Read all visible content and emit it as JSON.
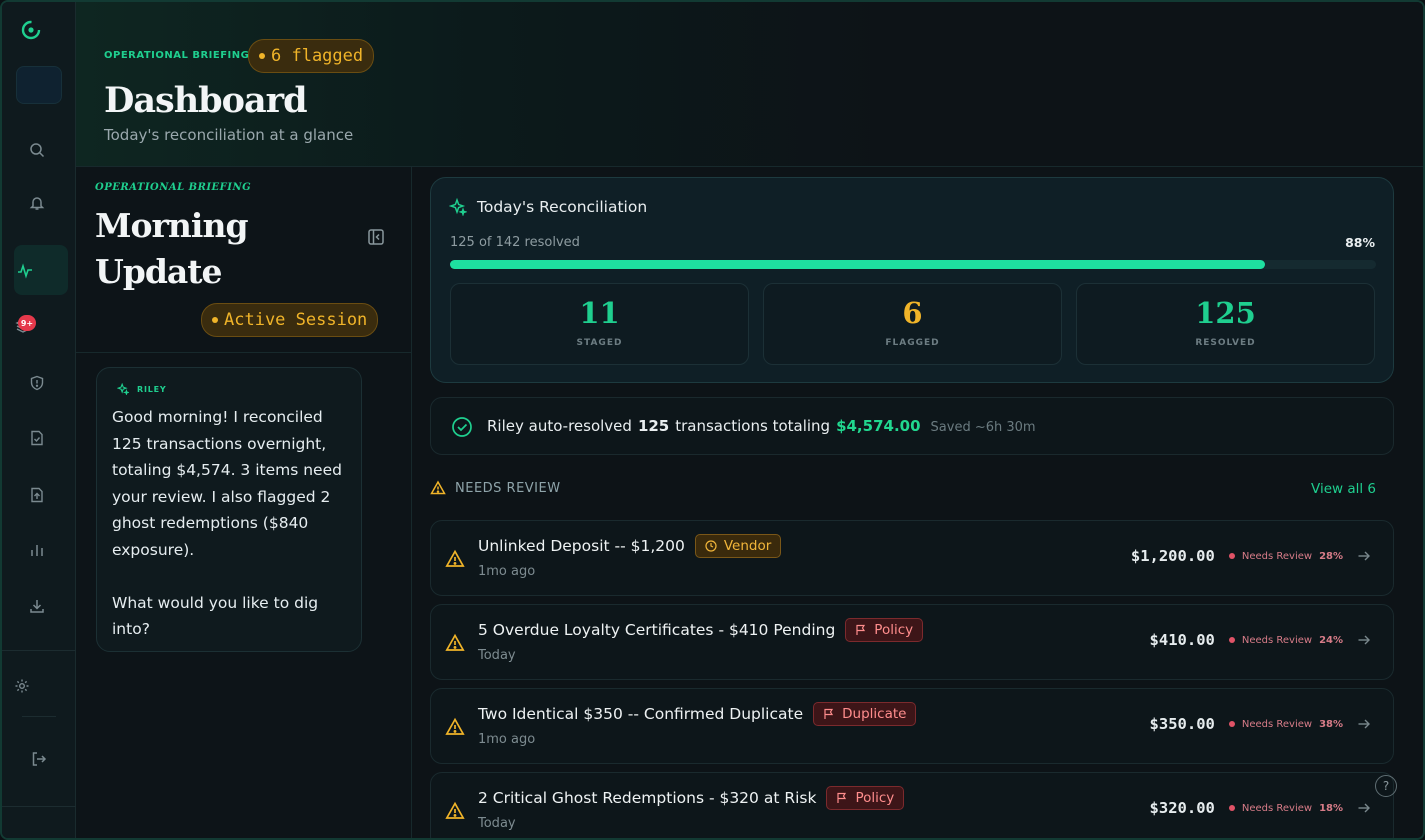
{
  "header": {
    "eyebrow": "OPERATIONAL BRIEFING",
    "flag_pill": "6 flagged",
    "title": "Dashboard",
    "subtitle": "Today's reconciliation at a glance"
  },
  "rail": {
    "notifications_badge": "9+",
    "icons": [
      "logo-icon",
      "search-icon",
      "bell-icon",
      "activity-icon",
      "layers-icon",
      "shield-icon",
      "file-check-icon",
      "file-upload-icon",
      "bar-chart-icon",
      "download-icon",
      "settings-icon",
      "logout-icon"
    ]
  },
  "briefing": {
    "eyebrow": "OPERATIONAL BRIEFING",
    "title": "Morning Update",
    "session_pill": "Active Session",
    "assistant_name": "RILEY",
    "message": "Good morning! I reconciled 125 transactions overnight, totaling $4,574. 3 items need your review. I also flagged 2 ghost redemptions ($840 exposure).\n\nWhat would you like to dig into?"
  },
  "reconciliation": {
    "title": "Today's Reconciliation",
    "progress_label": "125 of 142 resolved",
    "progress_pct_label": "88%",
    "progress_fraction": 0.88,
    "stats": [
      {
        "value": "11",
        "label": "STAGED",
        "color": "#1fcf8f"
      },
      {
        "value": "6",
        "label": "FLAGGED",
        "color": "#f0b429"
      },
      {
        "value": "125",
        "label": "RESOLVED",
        "color": "#1fcf8f"
      }
    ]
  },
  "auto_resolved": {
    "prefix": "Riley auto-resolved",
    "count": "125",
    "middle": "transactions totaling",
    "amount": "$4,574.00",
    "saved": "Saved ~6h 30m"
  },
  "needs_review": {
    "heading": "NEEDS REVIEW",
    "view_all": "View all 6",
    "items": [
      {
        "title": "Unlinked Deposit -- $1,200",
        "tag": "Vendor",
        "tag_type": "vendor",
        "time": "1mo ago",
        "amount": "$1,200.00",
        "status": "Needs Review",
        "pct": "28%"
      },
      {
        "title": "5 Overdue Loyalty Certificates - $410 Pending",
        "tag": "Policy",
        "tag_type": "policy",
        "time": "Today",
        "amount": "$410.00",
        "status": "Needs Review",
        "pct": "24%"
      },
      {
        "title": "Two Identical $350 -- Confirmed Duplicate",
        "tag": "Duplicate",
        "tag_type": "duplicate",
        "time": "1mo ago",
        "amount": "$350.00",
        "status": "Needs Review",
        "pct": "38%"
      },
      {
        "title": "2 Critical Ghost Redemptions - $320 at Risk",
        "tag": "Policy",
        "tag_type": "policy",
        "time": "Today",
        "amount": "$320.00",
        "status": "Needs Review",
        "pct": "18%"
      }
    ]
  },
  "help_label": "?"
}
